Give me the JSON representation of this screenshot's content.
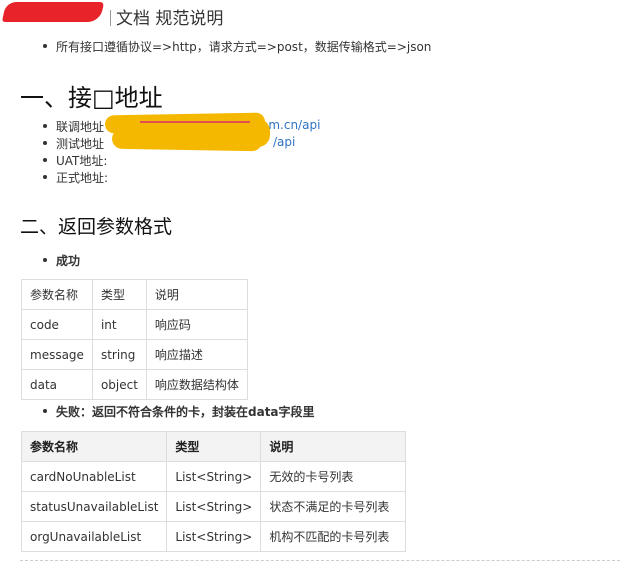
{
  "doc": {
    "title": "文档 规范说明",
    "intro_bullet": "所有接口遵循协议=>http，请求方式=>post，数据传输格式=>json"
  },
  "section1": {
    "heading": "一、接□地址",
    "items": [
      {
        "label": "联调地址",
        "tail": "om.cn/api"
      },
      {
        "label": "测试地址",
        "tail": "/api"
      },
      {
        "label": "UAT地址:",
        "tail": ""
      },
      {
        "label": "正式地址:",
        "tail": ""
      }
    ]
  },
  "section2": {
    "heading": "二、返回参数格式",
    "success_label": "成功",
    "success_table": {
      "headers": [
        "参数名称",
        "类型",
        "说明"
      ],
      "rows": [
        [
          "code",
          "int",
          "响应码"
        ],
        [
          "message",
          "string",
          "响应描述"
        ],
        [
          "data",
          "object",
          "响应数据结构体"
        ]
      ]
    },
    "fail_label": "失败：返回不符合条件的卡，封装在data字段里",
    "fail_table": {
      "headers": [
        "参数名称",
        "类型",
        "说明"
      ],
      "rows": [
        [
          "cardNoUnableList",
          "List<String>",
          "无效的卡号列表"
        ],
        [
          "statusUnavailableList",
          "List<String>",
          "状态不满足的卡号列表"
        ],
        [
          "orgUnavailableList",
          "List<String>",
          "机构不匹配的卡号列表"
        ]
      ]
    }
  },
  "colors": {
    "link": "#2f73c5",
    "redaction_yellow": "#f5b800",
    "redaction_red": "#e8232a"
  }
}
